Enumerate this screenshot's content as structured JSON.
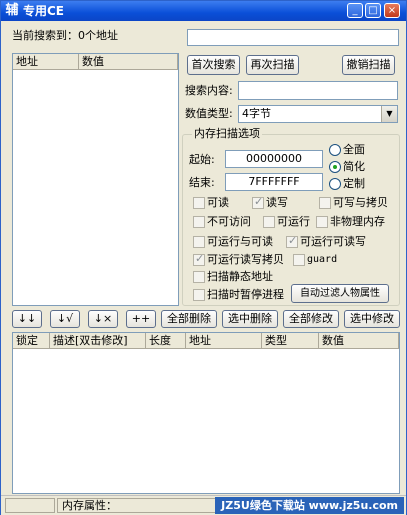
{
  "window": {
    "icon_char": "辅",
    "title": "专用CE",
    "minimize": "_",
    "maximize": "□",
    "close": "×"
  },
  "search_status": "当前搜索到：0个地址",
  "results_list": {
    "col_address": "地址",
    "col_value": "数值"
  },
  "buttons": {
    "first_scan": "首次搜索",
    "next_scan": "再次扫描",
    "undo_scan": "撤销扫描",
    "auto_filter": "自动过滤人物属性"
  },
  "search_content": {
    "label": "搜索内容:",
    "value": ""
  },
  "value_type": {
    "label": "数值类型:",
    "selected": "4字节"
  },
  "memory_options": {
    "title": "内存扫描选项",
    "start_label": "起始:",
    "start_value": "00000000",
    "end_label": "结束:",
    "end_value": "7FFFFFFF",
    "radios": [
      {
        "label": "全面",
        "checked": false
      },
      {
        "label": "简化",
        "checked": true
      },
      {
        "label": "定制",
        "checked": false
      }
    ],
    "checks": [
      {
        "label": "可读",
        "checked": false
      },
      {
        "label": "读写",
        "checked": true
      },
      {
        "label": "可写与拷贝",
        "checked": false
      },
      {
        "label": "不可访问",
        "checked": false
      },
      {
        "label": "可运行",
        "checked": false
      },
      {
        "label": "非物理内存",
        "checked": false
      },
      {
        "label": "可运行与可读",
        "checked": false
      },
      {
        "label": "可运行可读写",
        "checked": true
      },
      {
        "label": "可运行读写拷贝",
        "checked": true
      },
      {
        "label": "guard",
        "checked": false
      },
      {
        "label": "扫描静态地址",
        "checked": false
      },
      {
        "label": "扫描时暂停进程",
        "checked": false
      }
    ]
  },
  "toolbar": {
    "add_all": "↓↓",
    "add_selected": "↓√",
    "remove": "↓×",
    "add_manual": "++",
    "delete_all": "全部删除",
    "delete_selected": "选中删除",
    "modify_all": "全部修改",
    "modify_selected": "选中修改"
  },
  "address_table": {
    "columns": [
      "锁定",
      "描述[双击修改]",
      "长度",
      "地址",
      "类型",
      "数值"
    ]
  },
  "statusbar": {
    "memory_attr": "内存属性：",
    "watermark": "JZ5U绿色下载站 www.jz5u.com"
  }
}
